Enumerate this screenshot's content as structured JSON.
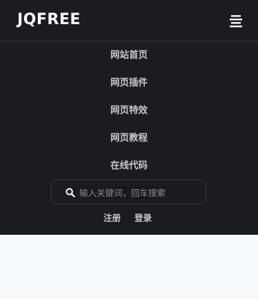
{
  "header": {
    "logo_text": "JQFREE",
    "menu_icon": "hamburger-menu-icon"
  },
  "nav": {
    "items": [
      {
        "label": "网站首页"
      },
      {
        "label": "网页插件"
      },
      {
        "label": "网页特效"
      },
      {
        "label": "网页教程"
      },
      {
        "label": "在线代码"
      }
    ]
  },
  "search": {
    "icon": "search-icon",
    "placeholder": "输入关键词，回车搜索",
    "value": ""
  },
  "auth": {
    "register_label": "注册",
    "login_label": "登录"
  },
  "colors": {
    "header_bg": "#1c1c1e",
    "page_bg": "#f7f8fa",
    "text": "#c8c8c8"
  }
}
